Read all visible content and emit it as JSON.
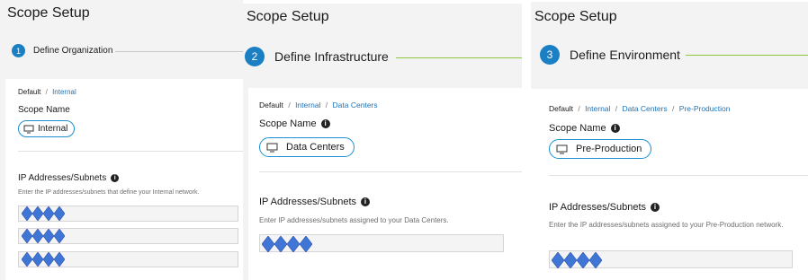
{
  "colors": {
    "accent": "#1b7fc4",
    "link": "#1f73b7",
    "step_line": "#8dc63f",
    "diamond": "#3f76d6"
  },
  "panels": [
    {
      "title": "Scope Setup",
      "step_number": "1",
      "step_label": "Define Organization",
      "breadcrumb": [
        {
          "text": "Default",
          "link": false
        },
        {
          "text": "Internal",
          "link": true
        }
      ],
      "scope_name_label": "Scope Name",
      "scope_name_value": "Internal",
      "scope_icon": "monitor-icon",
      "ip_label": "IP Addresses/Subnets",
      "ip_help": "Enter the IP addresses/subnets that define your Internal network."
    },
    {
      "title": "Scope Setup",
      "step_number": "2",
      "step_label": "Define Infrastructure",
      "breadcrumb": [
        {
          "text": "Default",
          "link": false
        },
        {
          "text": "Internal",
          "link": true
        },
        {
          "text": "Data Centers",
          "link": true
        }
      ],
      "scope_name_label": "Scope Name",
      "scope_name_value": "Data Centers",
      "scope_icon": "monitor-icon",
      "ip_label": "IP Addresses/Subnets",
      "ip_help": "Enter IP addresses/subnets assigned to your Data Centers."
    },
    {
      "title": "Scope Setup",
      "step_number": "3",
      "step_label": "Define Environment",
      "breadcrumb": [
        {
          "text": "Default",
          "link": false
        },
        {
          "text": "Internal",
          "link": true
        },
        {
          "text": "Data Centers",
          "link": true
        },
        {
          "text": "Pre-Production",
          "link": true
        }
      ],
      "scope_name_label": "Scope Name",
      "scope_name_value": "Pre-Production",
      "scope_icon": "monitor-icon",
      "ip_label": "IP Addresses/Subnets",
      "ip_help": "Enter the IP addresses/subnets assigned to your Pre-Production network."
    }
  ],
  "separator": "/",
  "info_glyph": "i"
}
